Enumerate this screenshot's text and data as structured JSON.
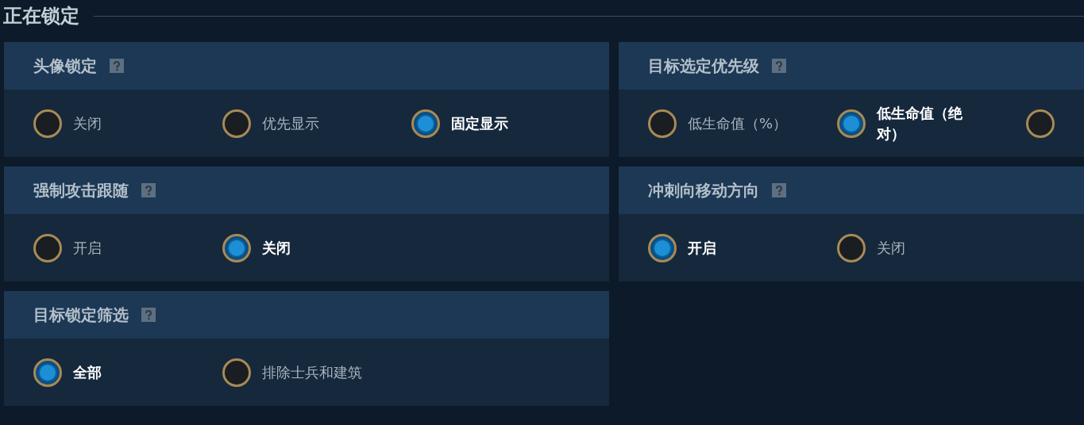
{
  "section_title": "正在锁定",
  "cards": [
    {
      "title": "头像锁定",
      "help": true,
      "options": [
        {
          "label": "关闭",
          "selected": false
        },
        {
          "label": "优先显示",
          "selected": false
        },
        {
          "label": "固定显示",
          "selected": true
        }
      ]
    },
    {
      "title": "目标选定优先级",
      "help": true,
      "options": [
        {
          "label": "低生命值（%）",
          "selected": false
        },
        {
          "label": "低生命值（绝对）",
          "selected": true
        },
        {
          "selected": false
        }
      ]
    },
    {
      "title": "强制攻击跟随",
      "help": true,
      "options": [
        {
          "label": "开启",
          "selected": false
        },
        {
          "label": "关闭",
          "selected": true
        }
      ]
    },
    {
      "title": "冲刺向移动方向",
      "help": true,
      "options": [
        {
          "label": "开启",
          "selected": true
        },
        {
          "label": "关闭",
          "selected": false
        }
      ]
    },
    {
      "title": "目标锁定筛选",
      "help": true,
      "options": [
        {
          "label": "全部",
          "selected": true
        },
        {
          "label": "排除士兵和建筑",
          "selected": false
        }
      ]
    }
  ]
}
